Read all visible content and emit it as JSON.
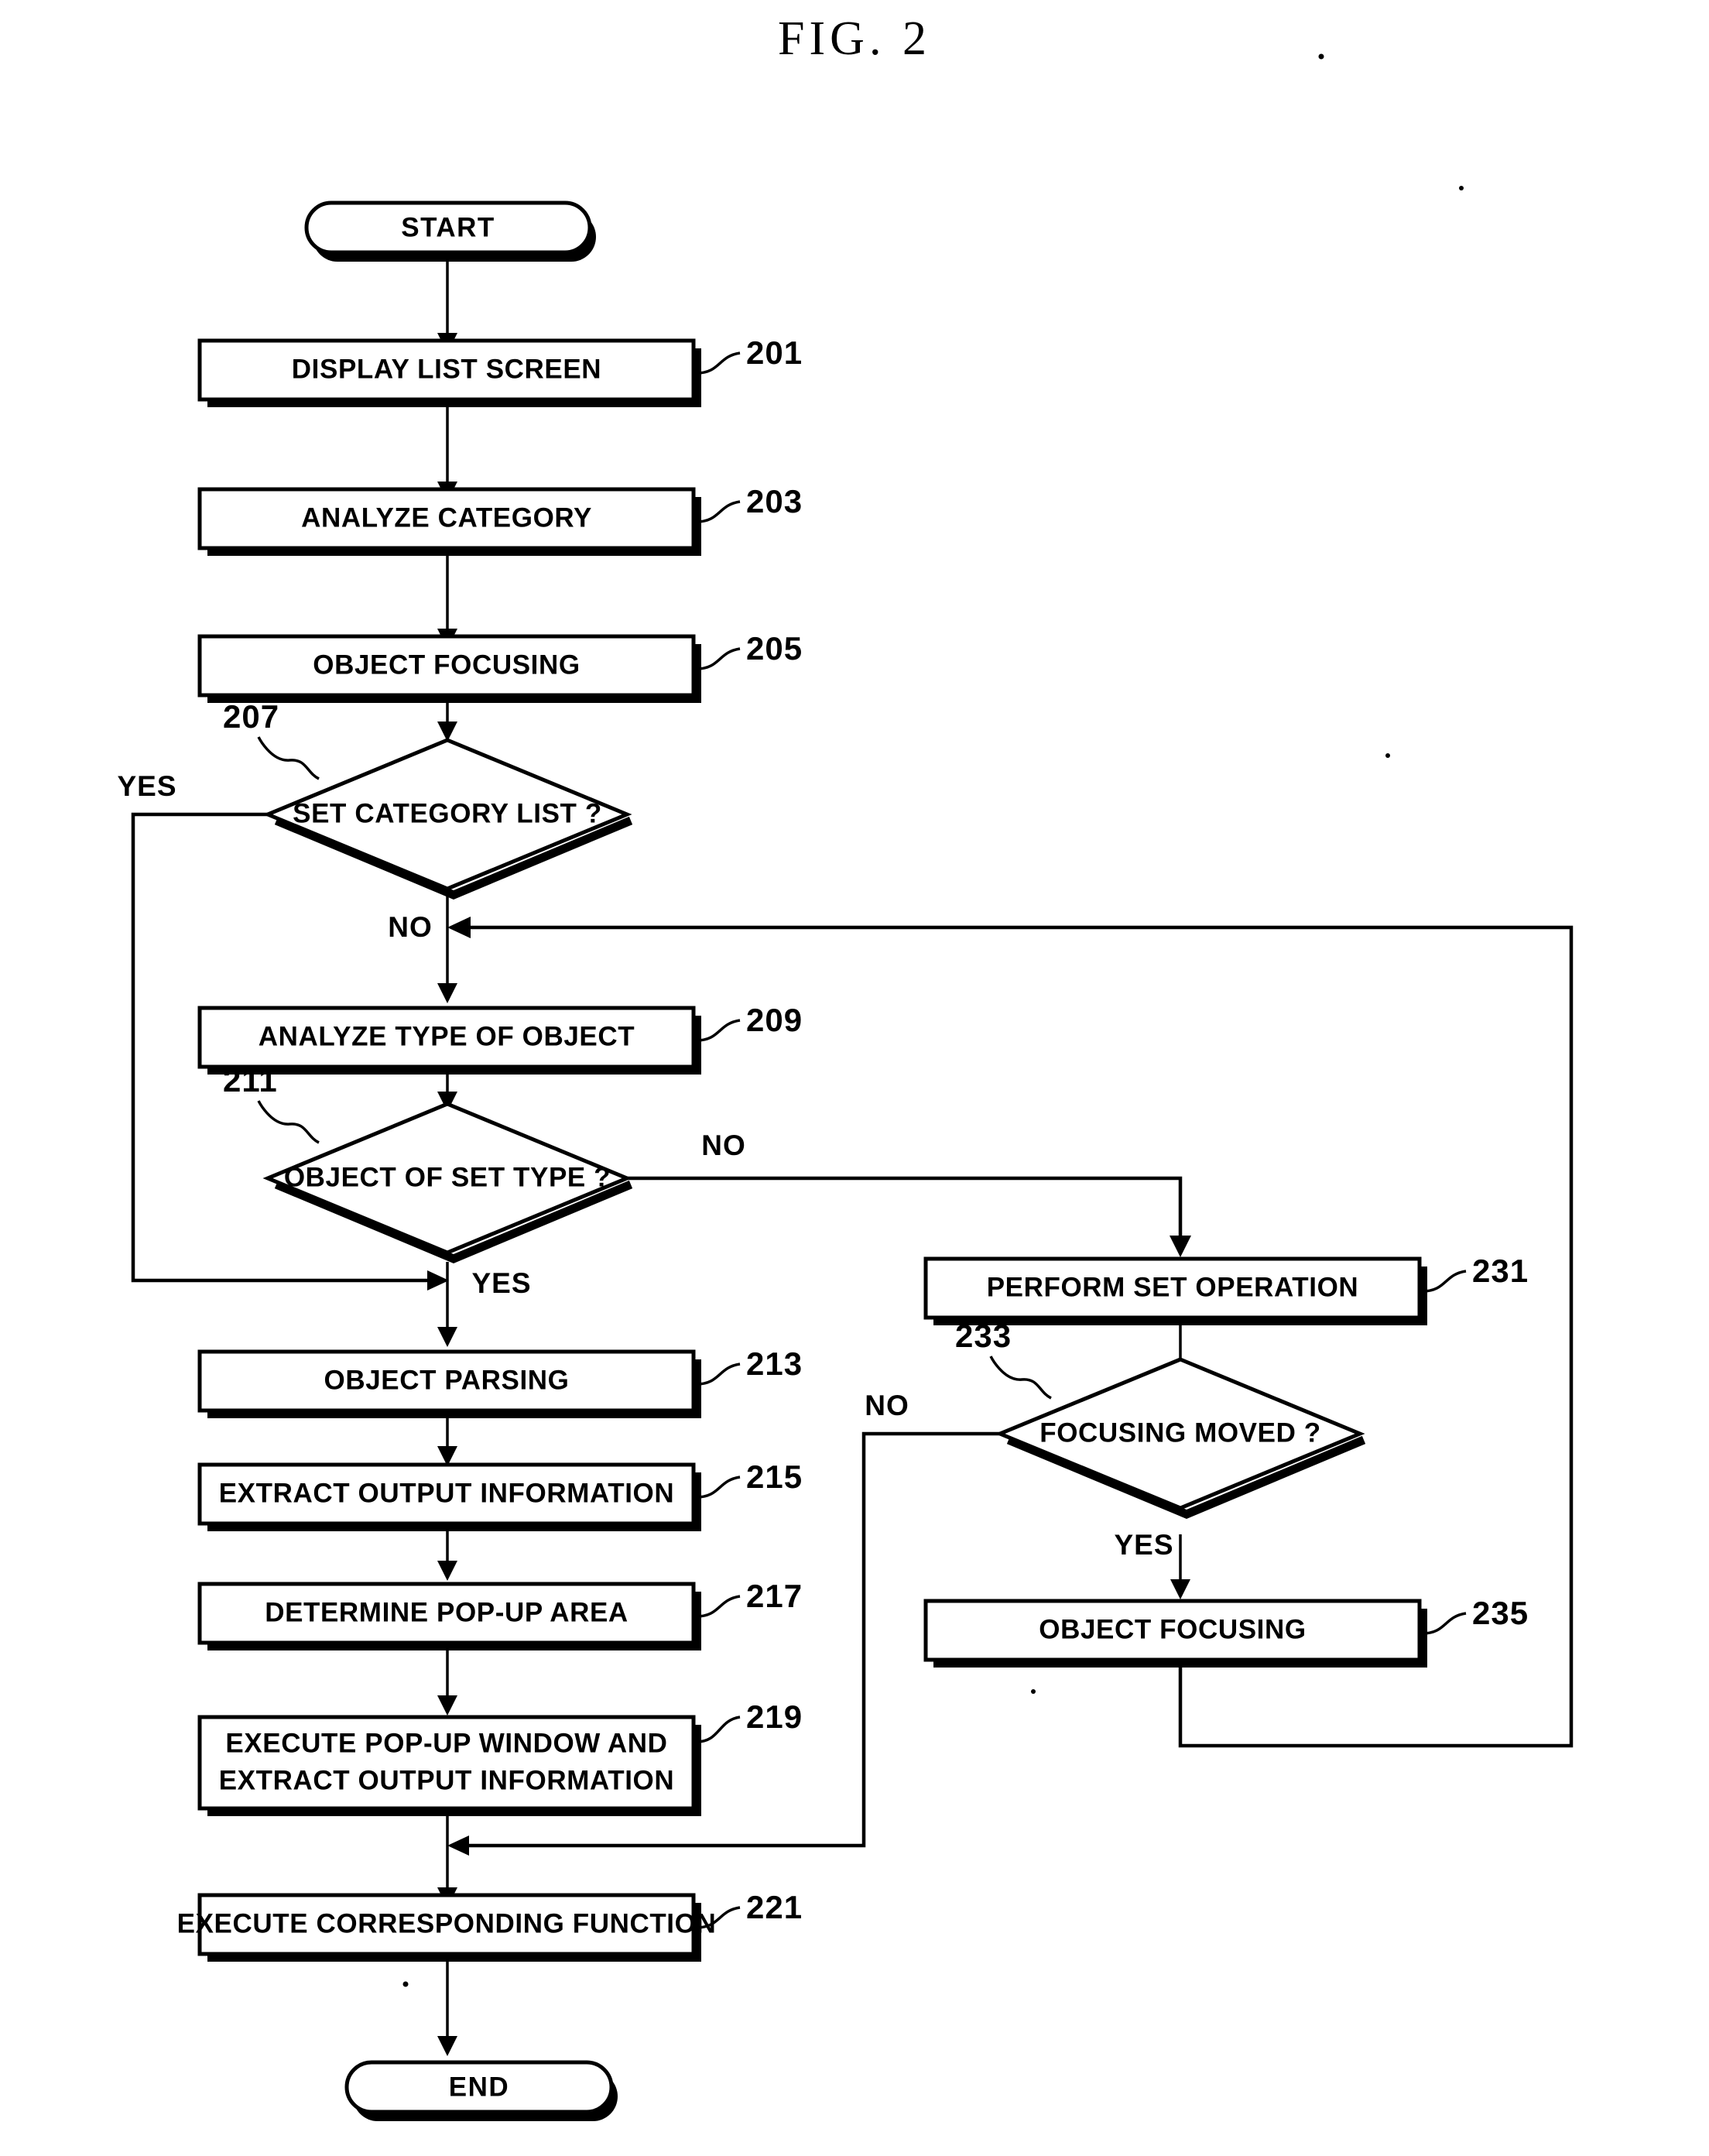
{
  "figure": {
    "title": "FIG. 2",
    "type": "patent-flowchart"
  },
  "terminators": [
    {
      "id": "start",
      "label": "START"
    },
    {
      "id": "end",
      "label": "END"
    }
  ],
  "process_steps": [
    {
      "ref": "201",
      "label": "DISPLAY LIST SCREEN"
    },
    {
      "ref": "203",
      "label": "ANALYZE CATEGORY"
    },
    {
      "ref": "205",
      "label": "OBJECT FOCUSING"
    },
    {
      "ref": "209",
      "label": "ANALYZE TYPE OF OBJECT"
    },
    {
      "ref": "213",
      "label": "OBJECT PARSING"
    },
    {
      "ref": "215",
      "label": "EXTRACT OUTPUT INFORMATION"
    },
    {
      "ref": "217",
      "label": "DETERMINE POP-UP AREA"
    },
    {
      "ref": "219",
      "label_line1": "EXECUTE POP-UP WINDOW AND",
      "label_line2": "EXTRACT OUTPUT INFORMATION"
    },
    {
      "ref": "221",
      "label": "EXECUTE CORRESPONDING FUNCTION"
    },
    {
      "ref": "231",
      "label": "PERFORM SET OPERATION"
    },
    {
      "ref": "235",
      "label": "OBJECT FOCUSING"
    }
  ],
  "decisions": [
    {
      "ref": "207",
      "label": "SET CATEGORY LIST ?",
      "yes_label": "YES",
      "no_label": "NO"
    },
    {
      "ref": "211",
      "label": "OBJECT OF SET TYPE ?",
      "yes_label": "YES",
      "no_label": "NO"
    },
    {
      "ref": "233",
      "label": "FOCUSING MOVED ?",
      "yes_label": "YES",
      "no_label": "NO"
    }
  ],
  "branch_labels": {
    "d207_yes": "YES",
    "d207_no": "NO",
    "d211_no": "NO",
    "d211_yes": "YES",
    "d233_no": "NO",
    "d233_yes": "YES"
  },
  "colors": {
    "ink": "#000000",
    "paper": "#ffffff"
  }
}
